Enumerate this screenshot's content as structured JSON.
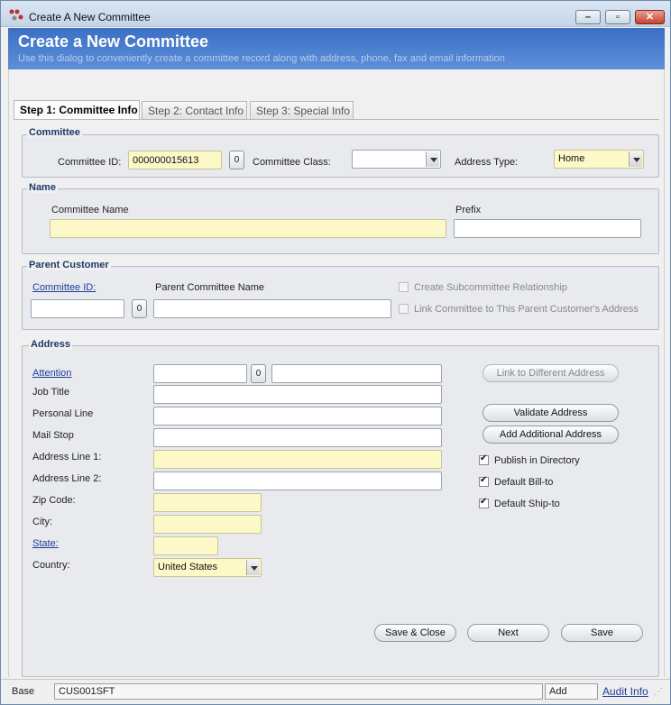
{
  "window": {
    "title": "Create A New Committee"
  },
  "banner": {
    "title": "Create a New Committee",
    "subtitle": "Use this dialog to conveniently create a committee record along with address, phone, fax and email information"
  },
  "tabs": [
    {
      "label": "Step 1: Committee Info",
      "active": true
    },
    {
      "label": "Step 2: Contact Info",
      "active": false
    },
    {
      "label": "Step 3: Special Info",
      "active": false
    }
  ],
  "committee": {
    "group_title": "Committee",
    "id_label": "Committee ID:",
    "id_value": "000000015613",
    "id_button": "0",
    "class_label": "Committee Class:",
    "class_value": "",
    "address_type_label": "Address Type:",
    "address_type_value": "Home"
  },
  "name": {
    "group_title": "Name",
    "committee_name_label": "Committee Name",
    "committee_name_value": "",
    "prefix_label": "Prefix",
    "prefix_value": ""
  },
  "parent": {
    "group_title": "Parent Customer",
    "id_link": "Committee ID:",
    "id_value": "",
    "id_button": "0",
    "name_label": "Parent Committee Name",
    "name_value": "",
    "create_subcommittee_label": "Create Subcommittee Relationship",
    "link_address_label": "Link Committee to This Parent Customer's Address"
  },
  "address": {
    "group_title": "Address",
    "attention_link": "Attention",
    "attention_button": "0",
    "job_title_label": "Job Title",
    "personal_line_label": "Personal Line",
    "mail_stop_label": "Mail Stop",
    "line1_label": "Address Line 1:",
    "line2_label": "Address Line 2:",
    "zip_label": "Zip Code:",
    "city_label": "City:",
    "state_link": "State:",
    "country_label": "Country:",
    "country_value": "United States",
    "link_different_button": "Link to Different Address",
    "validate_button": "Validate Address",
    "add_additional_button": "Add Additional Address",
    "publish_label": "Publish in Directory",
    "bill_to_label": "Default Bill-to",
    "ship_to_label": "Default Ship-to"
  },
  "actions": {
    "save_close": "Save & Close",
    "next": "Next",
    "save": "Save"
  },
  "status": {
    "base": "Base",
    "code": "CUS001SFT",
    "mode": "Add",
    "audit": "Audit Info"
  }
}
